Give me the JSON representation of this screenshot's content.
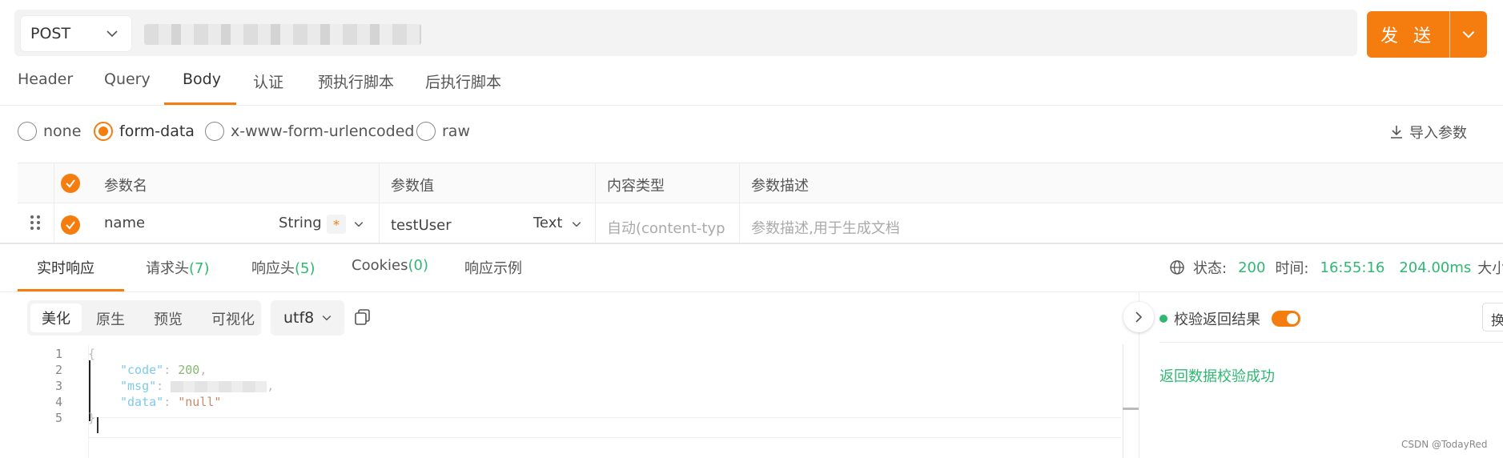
{
  "request": {
    "method": "POST",
    "send_label": "发 送"
  },
  "tabs": [
    "Header",
    "Query",
    "Body",
    "认证",
    "预执行脚本",
    "后执行脚本"
  ],
  "body_types": [
    "none",
    "form-data",
    "x-www-form-urlencoded",
    "raw"
  ],
  "import_label": "导入参数",
  "params_table": {
    "headers": [
      "参数名",
      "参数值",
      "内容类型",
      "参数描述"
    ],
    "row": {
      "name": "name",
      "type": "String",
      "required_mark": "*",
      "value": "testUser",
      "value_type": "Text",
      "content_type_placeholder": "自动(content-typ",
      "description_placeholder": "参数描述,用于生成文档"
    }
  },
  "response": {
    "tabs": [
      {
        "label": "实时响应",
        "count": ""
      },
      {
        "label": "请求头",
        "count": "(7)"
      },
      {
        "label": "响应头",
        "count": "(5)"
      },
      {
        "label": "Cookies",
        "count": "(0)"
      },
      {
        "label": "响应示例",
        "count": ""
      }
    ],
    "status_label": "状态:",
    "status_value": "200",
    "time_label": "时间:",
    "time_value": "16:55:16",
    "duration": "204.00ms",
    "size_label": "大小",
    "view_modes": [
      "美化",
      "原生",
      "预览",
      "可视化"
    ],
    "encoding": "utf8",
    "code_lines": [
      "1",
      "2",
      "3",
      "4",
      "5"
    ],
    "code": {
      "open": "{",
      "code_key": "\"code\"",
      "code_val": "200",
      "msg_key": "\"msg\"",
      "data_key": "\"data\"",
      "data_val": "\"null\"",
      "close": "}"
    },
    "verify_label": "校验返回结果",
    "verify_result": "返回数据校验成功",
    "side_button": "换"
  },
  "watermark": "CSDN @TodayRed",
  "colors": {
    "accent": "#f57c0e",
    "success": "#2eb872"
  }
}
